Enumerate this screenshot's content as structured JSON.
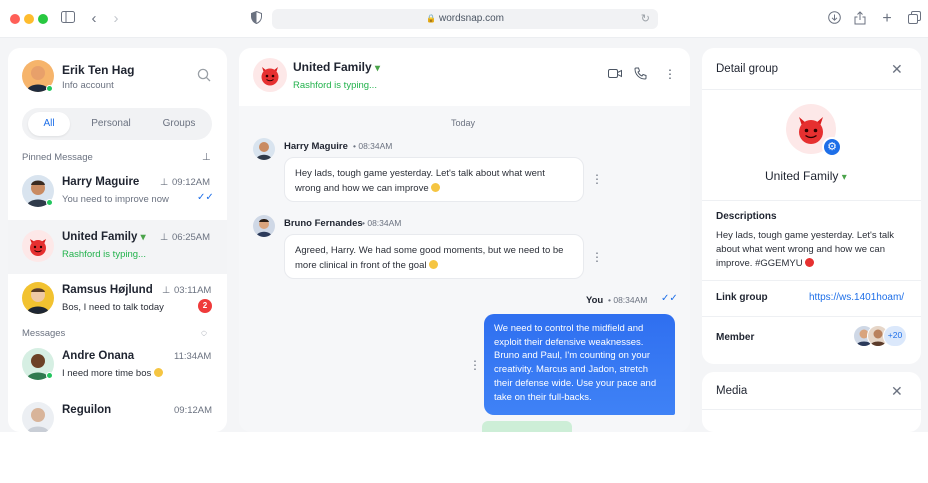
{
  "browser": {
    "url": "wordsnap.com"
  },
  "profile": {
    "name": "Erik Ten Hag",
    "subtitle": "Info account"
  },
  "tabs": [
    "All",
    "Personal",
    "Groups"
  ],
  "pinned_label": "Pinned Message",
  "messages_label": "Messages",
  "conversations": [
    {
      "name": "Harry Maguire",
      "time": "09:12AM",
      "preview": "You need to improve now"
    },
    {
      "name": "United Family",
      "time": "06:25AM",
      "preview": "Rashford is typing..."
    },
    {
      "name": "Ramsus Højlund",
      "time": "03:11AM",
      "preview": "Bos, I need to talk today",
      "unread": "2"
    },
    {
      "name": "Andre Onana",
      "time": "11:34AM",
      "preview": "I need more time bos"
    },
    {
      "name": "Reguilon",
      "time": "09:12AM",
      "preview": ""
    }
  ],
  "chat": {
    "title": "United Family",
    "status": "Rashford is typing...",
    "day_label": "Today",
    "msgs": [
      {
        "sender": "Harry Maguire",
        "time": "08:34AM",
        "text": "Hey lads, tough game yesterday. Let's talk about what went wrong and how we can improve"
      },
      {
        "sender": "Bruno Fernandes",
        "time": "08:34AM",
        "text": "Agreed, Harry. We had some good moments, but we need to be more clinical in front of the goal"
      },
      {
        "sender": "You",
        "time": "08:34AM",
        "text": "We need to control the midfield and exploit their defensive weaknesses. Bruno and Paul, I'm counting on your creativity. Marcus and Jadon, stretch their defense wide. Use your pace and take on their full-backs."
      }
    ]
  },
  "detail": {
    "header": "Detail group",
    "group_name": "United Family",
    "descriptions_label": "Descriptions",
    "description": "Hey lads, tough game yesterday. Let's talk about what went wrong and how we can improve. #GGEMYU",
    "link_label": "Link group",
    "link": "https://ws.1401hoam/",
    "member_label": "Member",
    "member_extra": "+20",
    "media_label": "Media"
  },
  "colors": {
    "accent": "#1e6fe8",
    "typing": "#22b24c",
    "unread": "#ef3b3b"
  }
}
